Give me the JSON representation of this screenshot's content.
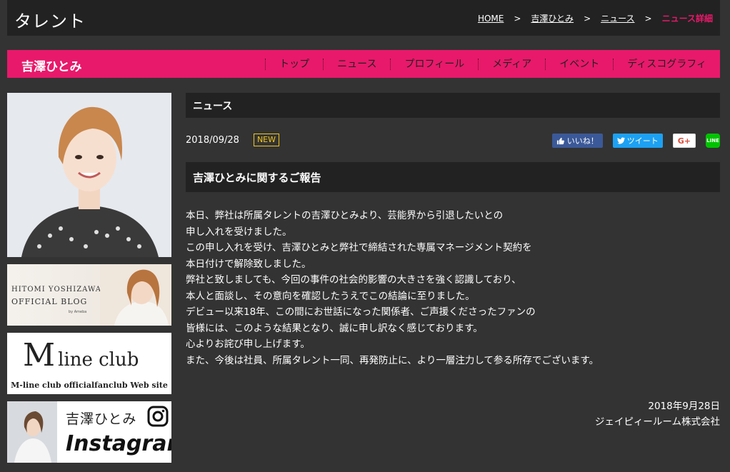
{
  "header": {
    "section_title": "タレント",
    "breadcrumb": {
      "home": "HOME",
      "talent": "吉澤ひとみ",
      "news": "ニュース",
      "current": "ニュース詳細",
      "separator": ">"
    }
  },
  "nav": {
    "talent_name": "吉澤ひとみ",
    "items": [
      "トップ",
      "ニュース",
      "プロフィール",
      "メディア",
      "イベント",
      "ディスコグラフィ"
    ]
  },
  "sidebar": {
    "blog_banner": {
      "line1": "HITOMI YOSHIZAWA",
      "line2": "OFFICIAL BLOG",
      "sub": "by Ameba"
    },
    "mline_banner": {
      "big": "M",
      "small": "line club",
      "sub": "M-line club officialfanclub Web site"
    },
    "insta_banner": {
      "name": "吉澤ひとみ",
      "word": "Instagram"
    }
  },
  "main": {
    "section_heading": "ニュース",
    "date": "2018/09/28",
    "badge": "NEW",
    "share": {
      "facebook": "いいね！",
      "twitter": "ツイート",
      "gplus": "G+",
      "line": "LINE"
    },
    "article_title": "吉澤ひとみに関するご報告",
    "body_lines": [
      "本日、弊社は所属タレントの吉澤ひとみより、芸能界から引退したいとの",
      "申し入れを受けました。",
      "この申し入れを受け、吉澤ひとみと弊社で締結された専属マネージメント契約を",
      "本日付けで解除致しました。",
      "弊社と致しましても、今回の事件の社会的影響の大きさを強く認識しており、",
      "本人と面談し、その意向を確認したうえでこの結論に至りました。",
      "デビュー以来18年、この間にお世話になった関係者、ご声援くださったファンの",
      "皆様には、このような結果となり、誠に申し訳なく感じております。",
      "心よりお詫び申し上げます。",
      "また、今後は社員、所属タレント一同、再発防止に、より一層注力して参る所存でございます。"
    ],
    "sign_date": "2018年9月28日",
    "sign_company": "ジェイピィールーム株式会社"
  },
  "colors": {
    "accent": "#e8196a",
    "background": "#333333",
    "bar": "#222222",
    "badge": "#f2c619"
  }
}
